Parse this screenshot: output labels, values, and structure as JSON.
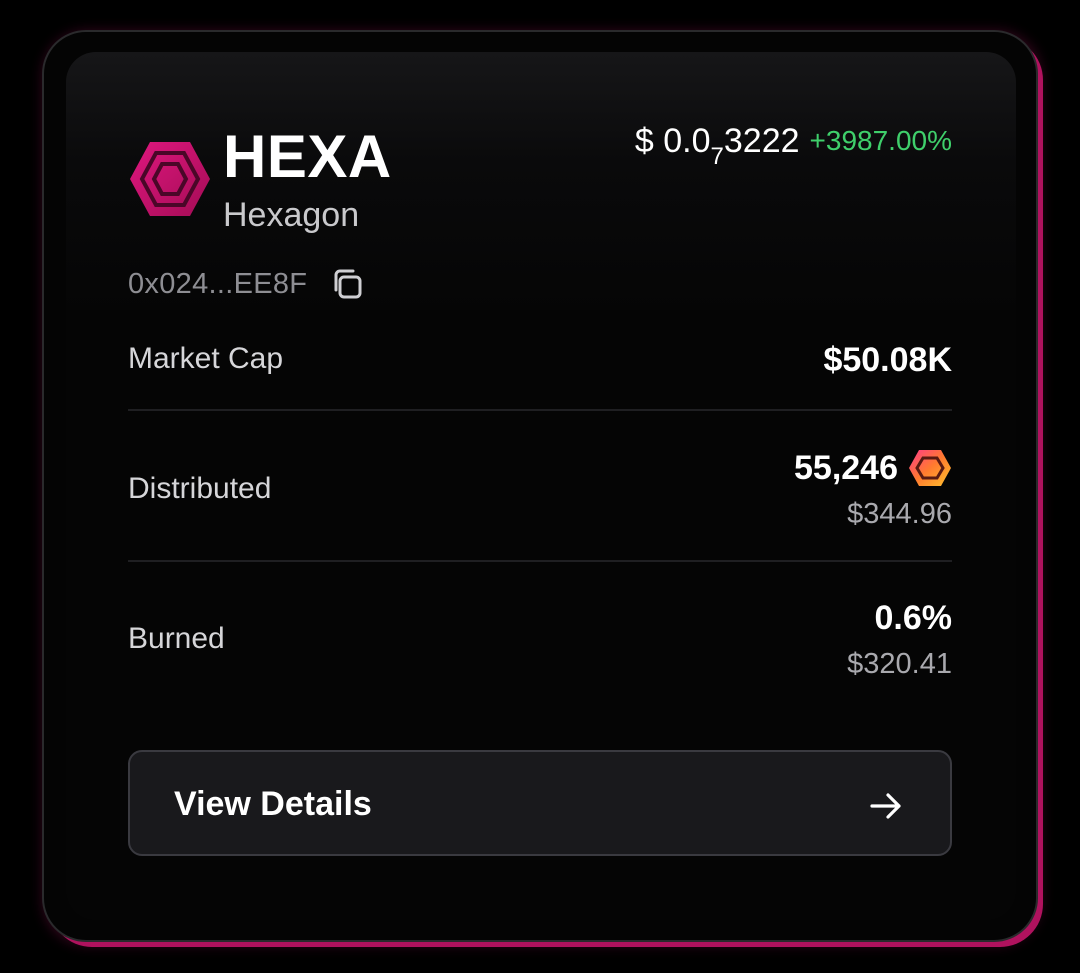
{
  "token": {
    "symbol": "HEXA",
    "name": "Hexagon",
    "logo_icon": "hexagon-logo",
    "address": "0x024...EE8F",
    "copy_icon": "copy-icon"
  },
  "price": {
    "currency": "$",
    "prefix": "0.0",
    "zero_count": "7",
    "digits": "3222",
    "change": "+3987.00%",
    "change_color": "#3fcf6b"
  },
  "stats": {
    "market_cap": {
      "label": "Market Cap",
      "value": "$50.08K"
    },
    "distributed": {
      "label": "Distributed",
      "value": "55,246",
      "usd": "$344.96",
      "icon": "hex-coin-icon"
    },
    "burned": {
      "label": "Burned",
      "value": "0.6%",
      "usd": "$320.41"
    }
  },
  "cta": {
    "label": "View Details",
    "icon": "arrow-right-icon"
  },
  "colors": {
    "accent": "#c2126b",
    "background": "#000000",
    "positive": "#3fcf6b"
  }
}
